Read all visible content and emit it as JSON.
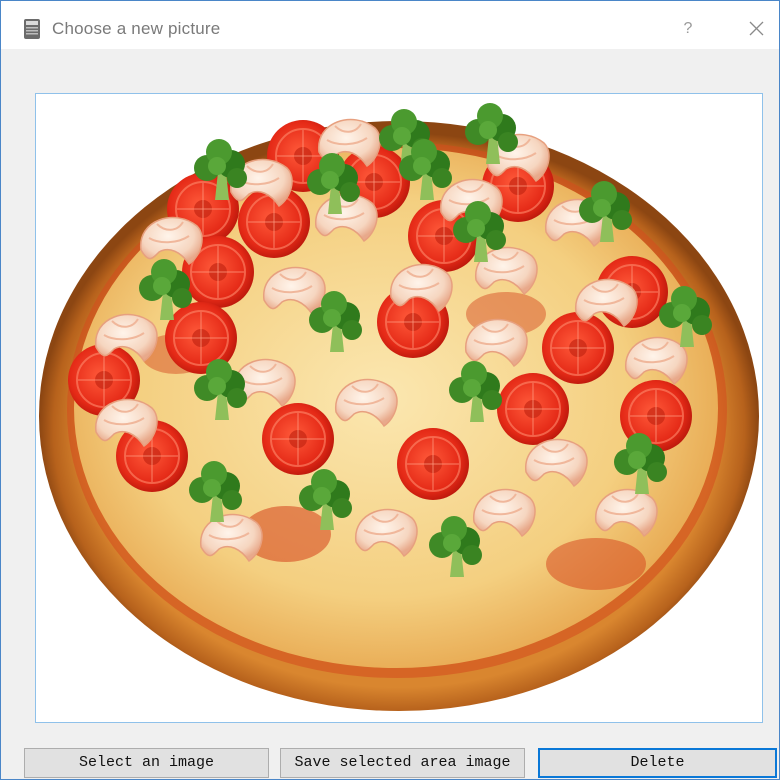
{
  "window": {
    "title": "Choose a new picture",
    "help_label": "?",
    "accent_color": "#0a78d7"
  },
  "icons": {
    "app": "app-icon",
    "help": "question-mark-icon",
    "close": "close-icon"
  },
  "image": {
    "content": "pizza-image"
  },
  "buttons": {
    "select_label": "Select an image",
    "save_label": "Save selected area image",
    "delete_label": "Delete"
  }
}
